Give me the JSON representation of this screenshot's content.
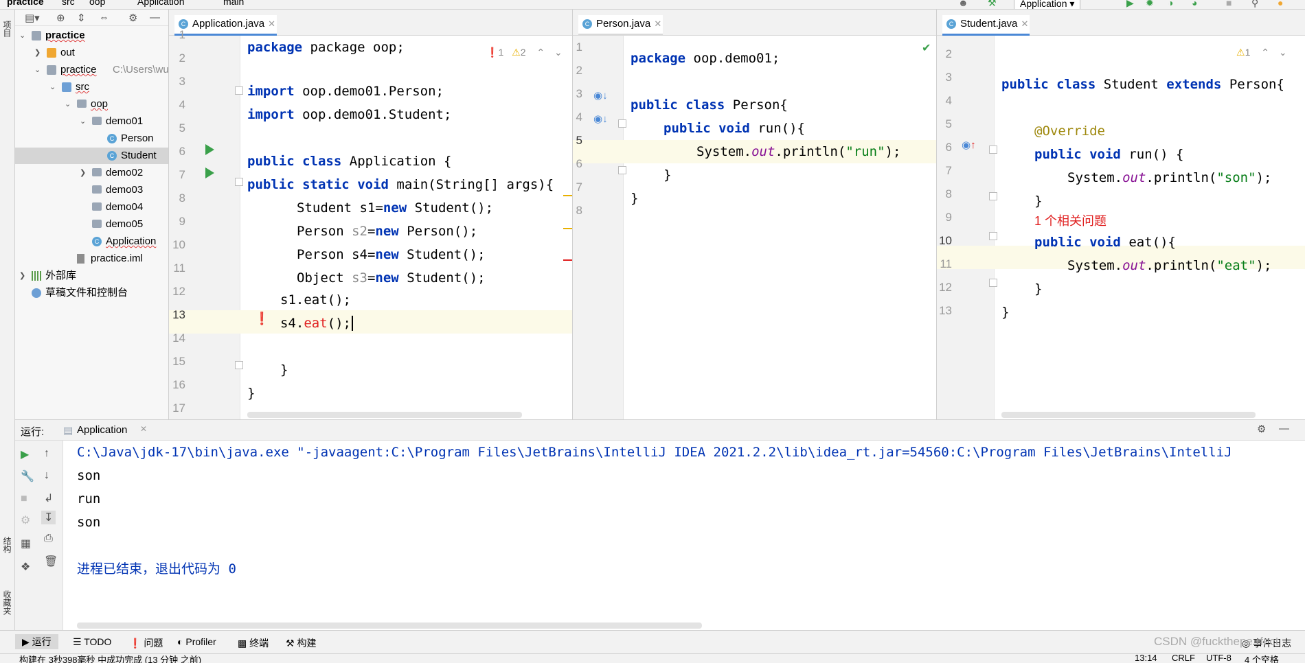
{
  "navbar": {
    "breadcrumbs": [
      "practice",
      "src",
      "oop",
      "Application",
      "main"
    ],
    "run_config": "Application"
  },
  "left_strip": {
    "project_label": "项目",
    "structure_label": "结构",
    "favorites_label": "收藏夹"
  },
  "project_tree": [
    {
      "label": "practice",
      "indent": 0,
      "arrow": "down",
      "icon": "module-folder",
      "squiggle": true
    },
    {
      "label": "out",
      "indent": 1,
      "arrow": "right",
      "icon": "folder-orange"
    },
    {
      "label": "practice",
      "path": "C:\\Users\\wu",
      "indent": 1,
      "arrow": "down",
      "icon": "module-folder",
      "squiggle": true
    },
    {
      "label": "src",
      "indent": 2,
      "arrow": "down",
      "icon": "folder-blue",
      "squiggle": true
    },
    {
      "label": "oop",
      "indent": 3,
      "arrow": "down",
      "icon": "package",
      "squiggle": true
    },
    {
      "label": "demo01",
      "indent": 4,
      "arrow": "down",
      "icon": "package"
    },
    {
      "label": "Person",
      "indent": 5,
      "icon": "class"
    },
    {
      "label": "Student",
      "indent": 5,
      "icon": "class",
      "selected": true
    },
    {
      "label": "demo02",
      "indent": 4,
      "arrow": "right",
      "icon": "package"
    },
    {
      "label": "demo03",
      "indent": 4,
      "icon": "package"
    },
    {
      "label": "demo04",
      "indent": 4,
      "icon": "package"
    },
    {
      "label": "demo05",
      "indent": 4,
      "icon": "package"
    },
    {
      "label": "Application",
      "indent": 4,
      "icon": "class",
      "squiggle": true
    },
    {
      "label": "practice.iml",
      "indent": 3,
      "icon": "file"
    },
    {
      "label": "外部库",
      "indent": 0,
      "arrow": "right",
      "icon": "library"
    },
    {
      "label": "草稿文件和控制台",
      "indent": 0,
      "icon": "scratch"
    }
  ],
  "editors": {
    "application": {
      "tab": "Application.java",
      "inspection": {
        "errors": "1",
        "warnings": "2"
      },
      "lines": [
        "1",
        "2",
        "3",
        "4",
        "5",
        "6",
        "7",
        "8",
        "9",
        "10",
        "11",
        "12",
        "13",
        "14",
        "15",
        "16",
        "17"
      ]
    },
    "person": {
      "tab": "Person.java",
      "lines": [
        "1",
        "2",
        "3",
        "4",
        "5",
        "6",
        "7",
        "8"
      ]
    },
    "student": {
      "tab": "Student.java",
      "inspection": {
        "warnings": "1"
      },
      "related_problems": "1 个相关问题",
      "lines": [
        "2",
        "3",
        "4",
        "5",
        "6",
        "7",
        "8",
        "9",
        "10",
        "11",
        "12",
        "13"
      ]
    }
  },
  "code": {
    "app_package": "package oop;",
    "app_import1": "oop.demo01.Person;",
    "app_import2": "oop.demo01.Student;",
    "app_class": "Application {",
    "app_main_sig": "main(String[] args){",
    "app_s1_type": "Student s1=",
    "app_s1_new": "Student();",
    "app_s2_type": "Person ",
    "app_s2_var": "s2",
    "app_s2_new": "Person();",
    "app_s4_type": "Person s4=",
    "app_s4_new": "Student();",
    "app_s3_type": "Object ",
    "app_s3_var": "s3",
    "app_s3_new": "Student();",
    "app_call1": "s1.eat();",
    "app_call2_obj": "s4.",
    "app_call2_method": "eat",
    "app_call2_tail": "();",
    "person_package": "oop.demo01;",
    "person_class": "Person{",
    "person_run": "run(){",
    "person_print_pre": "System.",
    "person_print_out": "out",
    "person_print_mid": ".println(",
    "person_print_str": "\"run\"",
    "person_print_end": ");",
    "student_class_name": "Student",
    "student_extends_target": "Person{",
    "student_override": "@Override",
    "student_run": "run() {",
    "student_son_str": "\"son\"",
    "student_eat": "eat(){",
    "student_eat_str": "\"eat\"",
    "kw_package": "package",
    "kw_import": "import",
    "kw_public": "public",
    "kw_class": "class",
    "kw_static": "static",
    "kw_void": "void",
    "kw_new": "new",
    "kw_extends": "extends",
    "brace_close": "}"
  },
  "run_panel": {
    "label": "运行:",
    "tab": "Application",
    "output": [
      "C:\\Java\\jdk-17\\bin\\java.exe \"-javaagent:C:\\Program Files\\JetBrains\\IntelliJ IDEA 2021.2.2\\lib\\idea_rt.jar=54560:C:\\Program Files\\JetBrains\\IntelliJ",
      "son",
      "run",
      "son",
      "",
      "进程已结束，退出代码为 0"
    ]
  },
  "bottom_tools": [
    "运行",
    "TODO",
    "问题",
    "Profiler",
    "终端",
    "构建"
  ],
  "event_log": "事件日志",
  "watermark": "CSDN @fuckthepe rfect",
  "status": {
    "build_message": "构建在 3秒398毫秒 中成功完成 (13 分钟 之前)",
    "position": "13:14",
    "line_sep": "CRLF",
    "encoding": "UTF-8",
    "indent": "4 个空格"
  },
  "colors": {
    "keyword": "#0033b3",
    "string": "#067d17",
    "field": "#871094",
    "error": "#e02020",
    "accent": "#4a88d6"
  }
}
